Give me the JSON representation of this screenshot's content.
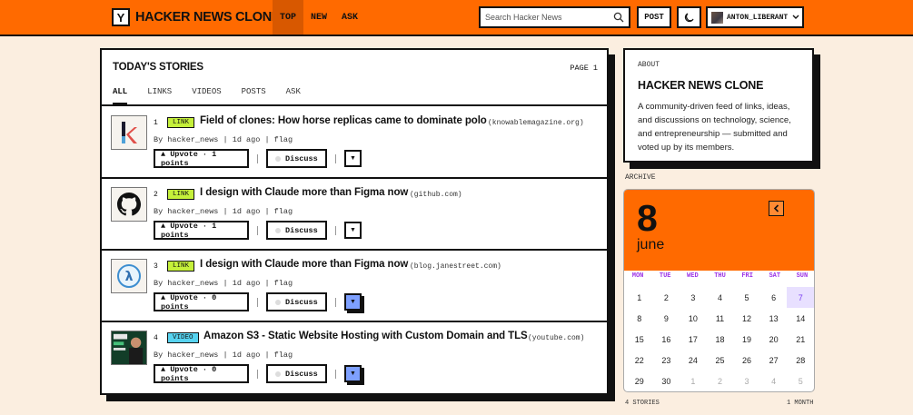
{
  "header": {
    "logo_letter": "Y",
    "brand": "HACKER NEWS CLONE",
    "nav": [
      {
        "label": "TOP",
        "active": true
      },
      {
        "label": "NEW",
        "active": false
      },
      {
        "label": "ASK",
        "active": false
      }
    ],
    "search_placeholder": "Search Hacker News",
    "post_label": "POST",
    "username": "ANTON_LIBERANT"
  },
  "stories_panel": {
    "title": "TODAY'S STORIES",
    "page_label": "PAGE 1",
    "tabs": [
      "ALL",
      "LINKS",
      "VIDEOS",
      "POSTS",
      "ASK"
    ],
    "active_tab": "ALL",
    "stories": [
      {
        "rank": "1",
        "type": "LINK",
        "title": "Field of clones: How horse replicas came to dominate polo",
        "domain": "(knowablemagazine.org)",
        "by": "By hacker_news",
        "age": "1d ago",
        "flag": "flag",
        "upvote": "▲ Upvote · 1 points",
        "discuss": "Discuss",
        "thumb_icon": "knowable-k-icon"
      },
      {
        "rank": "2",
        "type": "LINK",
        "title": "I design with Claude more than Figma now",
        "domain": "(github.com)",
        "by": "By hacker_news",
        "age": "1d ago",
        "flag": "flag",
        "upvote": "▲ Upvote · 1 points",
        "discuss": "Discuss",
        "thumb_icon": "github-icon"
      },
      {
        "rank": "3",
        "type": "LINK",
        "title": "I design with Claude more than Figma now",
        "domain": "(blog.janestreet.com)",
        "by": "By hacker_news",
        "age": "1d ago",
        "flag": "flag",
        "upvote": "▲ Upvote · 0 points",
        "discuss": "Discuss",
        "thumb_icon": "lambda-icon"
      },
      {
        "rank": "4",
        "type": "VIDEO",
        "title": "Amazon S3 - Static Website Hosting with Custom Domain and TLS",
        "domain": "(youtube.com)",
        "by": "By hacker_news",
        "age": "1d ago",
        "flag": "flag",
        "upvote": "▲ Upvote · 0 points",
        "discuss": "Discuss",
        "thumb_icon": "video-thumbnail"
      }
    ]
  },
  "about": {
    "label": "ABOUT",
    "title": "HACKER NEWS CLONE",
    "description": "A community-driven feed of links, ideas, and discussions on technology, science, and entrepreneurship — submitted and voted up by its members."
  },
  "archive": {
    "label": "ARCHIVE",
    "day": "8",
    "month": "june",
    "weekdays": [
      "MON",
      "TUE",
      "WED",
      "THU",
      "FRI",
      "SAT",
      "SUN"
    ],
    "days": [
      {
        "d": "1"
      },
      {
        "d": "2"
      },
      {
        "d": "3"
      },
      {
        "d": "4"
      },
      {
        "d": "5"
      },
      {
        "d": "6"
      },
      {
        "d": "7",
        "today": true
      },
      {
        "d": "8"
      },
      {
        "d": "9"
      },
      {
        "d": "10"
      },
      {
        "d": "11"
      },
      {
        "d": "12"
      },
      {
        "d": "13"
      },
      {
        "d": "14"
      },
      {
        "d": "15"
      },
      {
        "d": "16"
      },
      {
        "d": "17"
      },
      {
        "d": "18"
      },
      {
        "d": "19"
      },
      {
        "d": "20"
      },
      {
        "d": "21"
      },
      {
        "d": "22"
      },
      {
        "d": "23"
      },
      {
        "d": "24"
      },
      {
        "d": "25"
      },
      {
        "d": "26"
      },
      {
        "d": "27"
      },
      {
        "d": "28"
      },
      {
        "d": "29"
      },
      {
        "d": "30"
      },
      {
        "d": "1",
        "muted": true
      },
      {
        "d": "2",
        "muted": true
      },
      {
        "d": "3",
        "muted": true
      },
      {
        "d": "4",
        "muted": true
      },
      {
        "d": "5",
        "muted": true
      }
    ],
    "footer_left": "4 STORIES",
    "footer_right": "1 MONTH"
  },
  "colors": {
    "accent": "#ff6a00",
    "link_badge": "#c5f03a",
    "video_badge": "#57d3f0",
    "today": "#7a3cf0"
  }
}
